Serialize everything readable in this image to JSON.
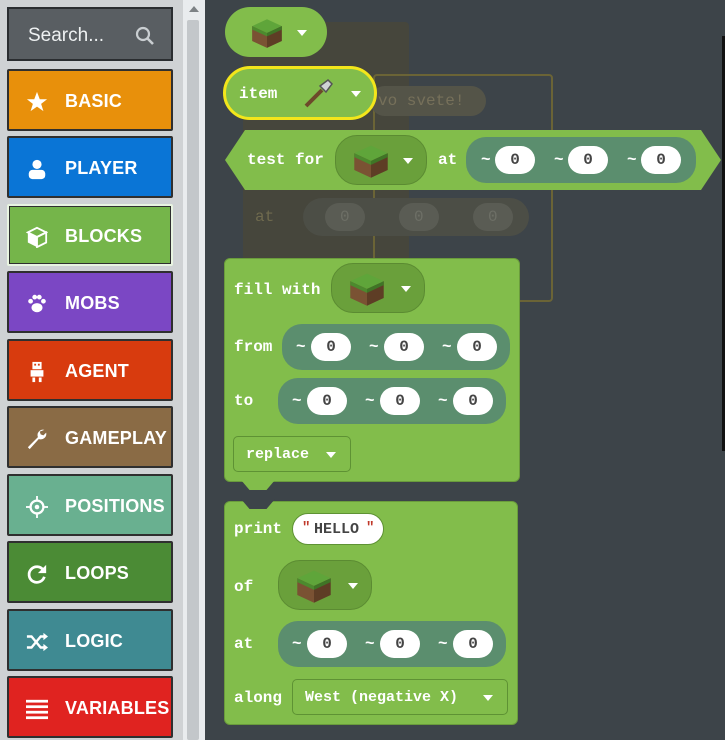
{
  "sidebar": {
    "search_placeholder": "Search...",
    "categories": [
      {
        "label": "BASIC",
        "color": "#e8900b",
        "icon": "star-icon"
      },
      {
        "label": "PLAYER",
        "color": "#0a75d6",
        "icon": "person-icon"
      },
      {
        "label": "BLOCKS",
        "color": "#75b54a",
        "icon": "cube-icon"
      },
      {
        "label": "MOBS",
        "color": "#7b47c4",
        "icon": "paw-icon"
      },
      {
        "label": "AGENT",
        "color": "#d83b0e",
        "icon": "agent-icon"
      },
      {
        "label": "GAMEPLAY",
        "color": "#8a6b45",
        "icon": "wrench-icon"
      },
      {
        "label": "POSITIONS",
        "color": "#69b090",
        "icon": "crosshair-icon"
      },
      {
        "label": "LOOPS",
        "color": "#4b8b35",
        "icon": "loop-icon"
      },
      {
        "label": "LOGIC",
        "color": "#3f8a92",
        "icon": "shuffle-icon"
      },
      {
        "label": "VARIABLES",
        "color": "#e02320",
        "icon": "list-icon"
      }
    ],
    "selected": "BLOCKS"
  },
  "workspace": {
    "ghost_text": "vo svete!",
    "ghost_at": "at",
    "ghost_zero": "0",
    "item_block": {
      "label": "item"
    },
    "test_for": {
      "label": "test for",
      "at": "at",
      "x": "0",
      "y": "0",
      "z": "0",
      "tilde": "~"
    },
    "fill_with": {
      "label": "fill with",
      "from": "from",
      "to": "to",
      "from_x": "0",
      "from_y": "0",
      "from_z": "0",
      "to_x": "0",
      "to_y": "0",
      "to_z": "0",
      "mode": "replace"
    },
    "print": {
      "label": "print",
      "text": "HELLO",
      "of": "of",
      "at": "at",
      "x": "0",
      "y": "0",
      "z": "0",
      "along": "along",
      "direction": "West (negative X)"
    }
  },
  "colors": {
    "block_green": "#82bd4b",
    "position_teal": "#5b8e6e",
    "workspace_bg": "#3d4449",
    "highlight": "#ffee00"
  }
}
